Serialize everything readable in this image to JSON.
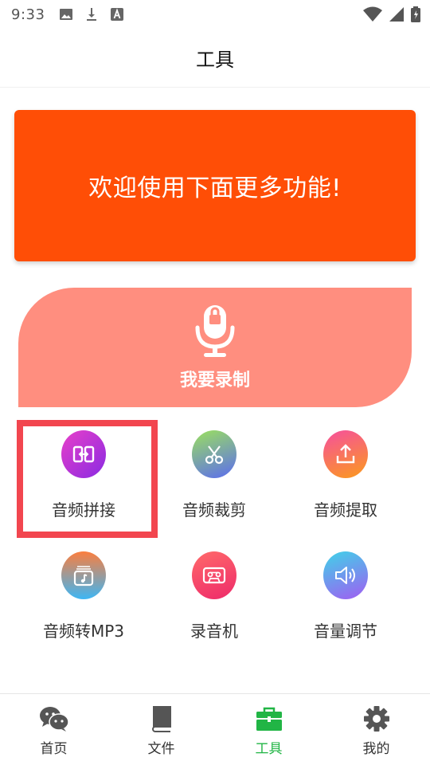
{
  "status_bar": {
    "time": "9:33",
    "left_icons": [
      "image-icon",
      "download-icon",
      "font-icon"
    ],
    "right_icons": [
      "wifi-icon",
      "signal-icon",
      "battery-icon"
    ]
  },
  "header": {
    "title": "工具"
  },
  "banner": {
    "text": "欢迎使用下面更多功能!",
    "color": "#ff4e06"
  },
  "record": {
    "label": "我要录制",
    "icon": "microphone-icon",
    "color": "#ff8e7f"
  },
  "tools": [
    {
      "label": "音频拼接",
      "icon": "merge-icon",
      "gradient": [
        "#e83fc9",
        "#8a2be2"
      ]
    },
    {
      "label": "音频裁剪",
      "icon": "scissors-icon",
      "gradient": [
        "#9be15d",
        "#5b6cf0"
      ]
    },
    {
      "label": "音频提取",
      "icon": "upload-icon",
      "gradient": [
        "#f64f9e",
        "#fb9b1c"
      ]
    },
    {
      "label": "音频转MP3",
      "icon": "music-file-icon",
      "gradient": [
        "#fb7e3e",
        "#3db6f5"
      ]
    },
    {
      "label": "录音机",
      "icon": "cassette-icon",
      "gradient": [
        "#ff6a6a",
        "#ee2a6a"
      ]
    },
    {
      "label": "音量调节",
      "icon": "speaker-icon",
      "gradient": [
        "#3fd3e8",
        "#a15cf2"
      ]
    }
  ],
  "nav": [
    {
      "label": "首页",
      "icon": "chat-icon",
      "active": false
    },
    {
      "label": "文件",
      "icon": "book-icon",
      "active": false
    },
    {
      "label": "工具",
      "icon": "toolbox-icon",
      "active": true
    },
    {
      "label": "我的",
      "icon": "gear-icon",
      "active": false
    }
  ],
  "colors": {
    "accent": "#21b545",
    "highlight": "#f2464f"
  }
}
